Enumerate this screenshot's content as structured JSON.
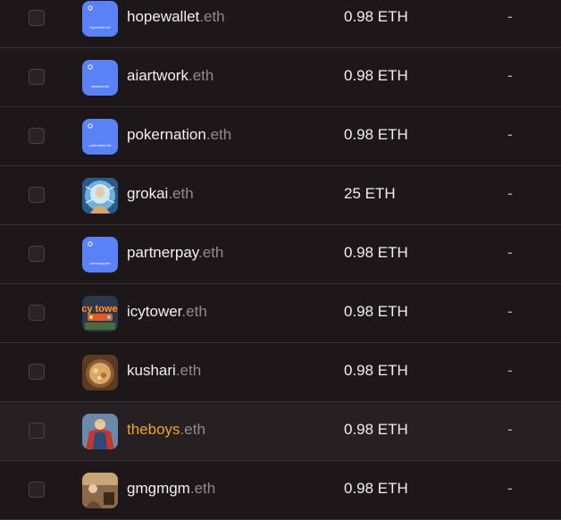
{
  "tld": ".eth",
  "colors": {
    "background": "#1e1719",
    "divider": "#3a3236",
    "highlight_name": "#f0a32b",
    "ens_default_avatar": "#5a82f6"
  },
  "rows": [
    {
      "label": "hopewallet",
      "price": "0.98 ETH",
      "extra": "-",
      "avatar": "ens-default-avatar-icon",
      "avatar_text": "hopewallet.eth"
    },
    {
      "label": "aiartwork",
      "price": "0.98 ETH",
      "extra": "-",
      "avatar": "ens-default-avatar-icon",
      "avatar_text": "aiartwork.eth"
    },
    {
      "label": "pokernation",
      "price": "0.98 ETH",
      "extra": "-",
      "avatar": "ens-default-avatar-icon",
      "avatar_text": "pokernation.eth"
    },
    {
      "label": "grokai",
      "price": "25 ETH",
      "extra": "-",
      "avatar": "grokai-avatar-icon"
    },
    {
      "label": "partnerpay",
      "price": "0.98 ETH",
      "extra": "-",
      "avatar": "ens-default-avatar-icon",
      "avatar_text": "partnerpay.eth"
    },
    {
      "label": "icytower",
      "price": "0.98 ETH",
      "extra": "-",
      "avatar": "icytower-avatar-icon",
      "avatar_text": "icy tower"
    },
    {
      "label": "kushari",
      "price": "0.98 ETH",
      "extra": "-",
      "avatar": "kushari-avatar-icon"
    },
    {
      "label": "theboys",
      "price": "0.98 ETH",
      "extra": "-",
      "avatar": "theboys-avatar-icon"
    },
    {
      "label": "gmgmgm",
      "price": "0.98 ETH",
      "extra": "-",
      "avatar": "gmgmgm-avatar-icon"
    }
  ]
}
